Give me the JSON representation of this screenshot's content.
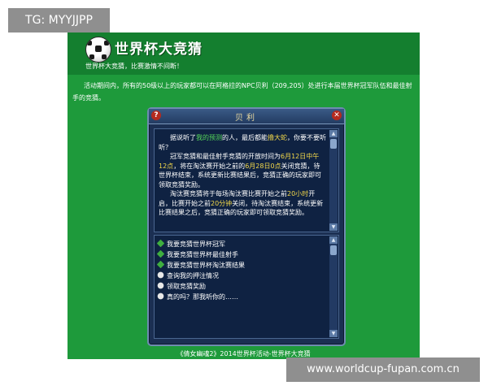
{
  "watermark_top": "TG: MYYJJPP",
  "watermark_bottom": "www.worldcup-fupan.com.cn",
  "banner": {
    "icon": "soccer-ball-icon",
    "title": "世界杯大竞猜",
    "subtitle": "世界杯大竞猜，比赛激情不间断！"
  },
  "intro_text": "活动期间内，所有的50级以上的玩家都可以在阿格拉的NPC贝利（209,205）处进行本届世界杯冠军队伍和最佳射手的竞猜。",
  "dialog": {
    "title": "贝利",
    "help_icon": "question-icon",
    "close_icon": "close-icon",
    "story": {
      "p1": [
        "据说听了",
        "我的预测",
        "的人，最后都能",
        "撸大蛇",
        "，你要不要听听？"
      ],
      "p2": [
        "冠军竞猜和最佳射手竞猜的开放时间为",
        "6月12日中午12点",
        "，将在淘汰赛开始之前的",
        "6月28日0点",
        "关闭竞猜，待世界杯结束，系统更新比赛结果后，竞猜正确的玩家即可领取竞猜奖励。"
      ],
      "p3": [
        "淘汰赛竞猜将于每场淘汰赛比赛开始之前",
        "20小时",
        "开启，比赛开始之前",
        "20分钟",
        "关闭，待淘汰赛结束，系统更新比赛结果之后，竞猜正确的玩家即可领取竞猜奖励。"
      ]
    },
    "menu": [
      {
        "label": "我要竞猜世界杯冠军",
        "icon": "quest-icon"
      },
      {
        "label": "我要竞猜世界杯最佳射手",
        "icon": "quest-icon"
      },
      {
        "label": "我要竞猜世界杯淘汰赛结果",
        "icon": "quest-icon"
      },
      {
        "label": "查询我的押注情况",
        "icon": "chat-icon"
      },
      {
        "label": "领取竞猜奖励",
        "icon": "chat-icon"
      },
      {
        "label": "真的吗？那我听你的……",
        "icon": "chat-icon"
      }
    ]
  },
  "footer": "《倩女幽魂2》2014世界杯活动-世界杯大竞猜",
  "colors": {
    "page_green": "#1e9a3b",
    "banner_green": "#147f2f",
    "dialog_navy": "#1b2f52",
    "highlight_green": "#56d85a",
    "highlight_yellow": "#f3d84a"
  }
}
